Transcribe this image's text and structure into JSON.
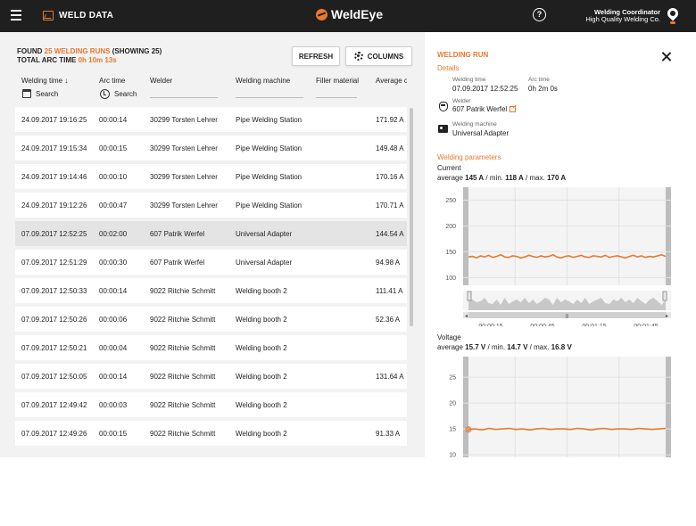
{
  "header": {
    "app_title": "WELD DATA",
    "logo_text": "WeldEye",
    "help_label": "?",
    "user_role": "Welding Coordinator",
    "user_company": "High Quality Welding Co."
  },
  "summary": {
    "found_prefix": "FOUND ",
    "found_count": "25 WELDING RUNS",
    "found_suffix": " (SHOWING 25)",
    "arc_prefix": "TOTAL ARC TIME ",
    "arc_value": "0h 10m 13s"
  },
  "toolbar": {
    "refresh_label": "REFRESH",
    "columns_label": "COLUMNS"
  },
  "table": {
    "columns": {
      "time": "Welding time ↓",
      "arc": "Arc time",
      "welder": "Welder",
      "machine": "Welding machine",
      "filler": "Filler material",
      "avg": "Average c"
    },
    "search_label": "Search",
    "rows": [
      {
        "time": "24.09.2017 19:16:25",
        "arc": "00:00:14",
        "welder": "30299 Torsten Lehrer",
        "machine": "Pipe Welding Station",
        "avg": "171.92 A"
      },
      {
        "time": "24.09.2017 19:15:34",
        "arc": "00:00:15",
        "welder": "30299 Torsten Lehrer",
        "machine": "Pipe Welding Station",
        "avg": "149.48 A"
      },
      {
        "time": "24.09.2017 19:14:46",
        "arc": "00:00:10",
        "welder": "30299 Torsten Lehrer",
        "machine": "Pipe Welding Station",
        "avg": "170.16 A"
      },
      {
        "time": "24.09.2017 19:12:26",
        "arc": "00:00:47",
        "welder": "30299 Torsten Lehrer",
        "machine": "Pipe Welding Station",
        "avg": "170.71 A"
      },
      {
        "time": "07.09.2017 12:52:25",
        "arc": "00:02:00",
        "welder": "607 Patrik Werfel",
        "machine": "Universal Adapter",
        "avg": "144.54 A"
      },
      {
        "time": "07.09.2017 12:51:29",
        "arc": "00:00:30",
        "welder": "607 Patrik Werfel",
        "machine": "Universal Adapter",
        "avg": "94.98 A"
      },
      {
        "time": "07.09.2017 12:50:33",
        "arc": "00:00:14",
        "welder": "9022 Ritchie Schmitt",
        "machine": "Welding booth 2",
        "avg": "111.41 A"
      },
      {
        "time": "07.09.2017 12:50:26",
        "arc": "00:00:06",
        "welder": "9022 Ritchie Schmitt",
        "machine": "Welding booth 2",
        "avg": "52.36 A"
      },
      {
        "time": "07.09.2017 12:50:21",
        "arc": "00:00:04",
        "welder": "9022 Ritchie Schmitt",
        "machine": "Welding booth 2",
        "avg": ""
      },
      {
        "time": "07.09.2017 12:50:05",
        "arc": "00:00:14",
        "welder": "9022 Ritchie Schmitt",
        "machine": "Welding booth 2",
        "avg": "131.64 A"
      },
      {
        "time": "07.09.2017 12:49:42",
        "arc": "00:00:03",
        "welder": "9022 Ritchie Schmitt",
        "machine": "Welding booth 2",
        "avg": ""
      },
      {
        "time": "07.09.2017 12:49:26",
        "arc": "00:00:15",
        "welder": "9022 Ritchie Schmitt",
        "machine": "Welding booth 2",
        "avg": "91.33 A"
      }
    ]
  },
  "detail": {
    "title": "WELDING RUN",
    "details_heading": "Details",
    "welding_time_label": "Welding time",
    "welding_time_value": "07.09.2017 12:52:25",
    "arc_time_label": "Arc time",
    "arc_time_value": "0h 2m 0s",
    "welder_label": "Welder",
    "welder_value": "607 Patrik Werfel",
    "machine_label": "Welding machine",
    "machine_value": "Universal Adapter",
    "params_heading": "Welding parameters",
    "current": {
      "title": "Current",
      "avg_prefix": "average ",
      "avg": "145 A",
      "min_prefix": " / min. ",
      "min": "118 A",
      "max_prefix": " / max. ",
      "max": "170 A"
    },
    "voltage": {
      "title": "Voltage",
      "avg_prefix": "average ",
      "avg": "15.7 V",
      "min_prefix": " / min. ",
      "min": "14.7 V",
      "max_prefix": " / max. ",
      "max": "16.8 V"
    }
  },
  "chart_data": [
    {
      "type": "line",
      "title": "Current",
      "ylim": [
        85,
        275
      ],
      "yticks": [
        100,
        150,
        200,
        250
      ],
      "xticks": [
        "00:00:15",
        "00:00:45",
        "00:01:15",
        "00:01:45"
      ],
      "series": [
        {
          "values": [
            140,
            141,
            138,
            142,
            140,
            143,
            139,
            141,
            144,
            140,
            139,
            142,
            141,
            138,
            140,
            143,
            141,
            139,
            142,
            140,
            141,
            144,
            140,
            138,
            141,
            142,
            139,
            141,
            143,
            140,
            139,
            142,
            141,
            140,
            143,
            139,
            141,
            142,
            140,
            138,
            141,
            143,
            140,
            142,
            139,
            141,
            140,
            142,
            144,
            141
          ]
        }
      ],
      "grid": true,
      "color": "#e8792e"
    },
    {
      "type": "line",
      "title": "Voltage",
      "ylim": [
        9.5,
        29
      ],
      "yticks": [
        10,
        15,
        20,
        25
      ],
      "series": [
        {
          "values": [
            14.9,
            15.0,
            14.8,
            15.1,
            14.9,
            15.0,
            15.1,
            14.9,
            15.0,
            14.8,
            15.0,
            15.1,
            14.9,
            15.0,
            15.0,
            14.9,
            15.1,
            15.0,
            14.8,
            15.0,
            15.1,
            14.9,
            15.0,
            15.0,
            14.9,
            15.1,
            15.0,
            14.9,
            15.0,
            15.1
          ]
        }
      ],
      "grid": true,
      "color": "#e8792e"
    }
  ]
}
